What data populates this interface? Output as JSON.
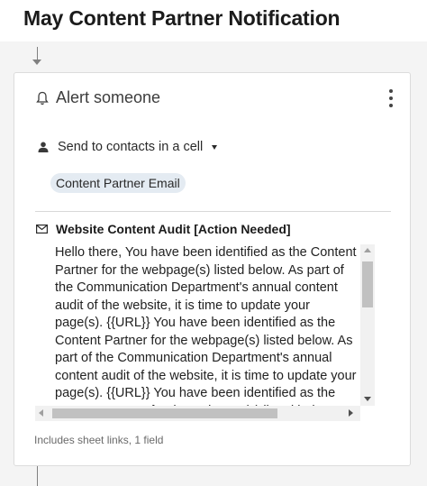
{
  "page": {
    "title": "May Content Partner Notification"
  },
  "card": {
    "action_label": "Alert someone",
    "more_icon": "vertical-ellipsis-icon",
    "recipient": {
      "label": "Send to contacts in a cell",
      "chip": "Content Partner Email"
    },
    "email": {
      "subject": "Website Content Audit [Action Needed]",
      "body": "Hello there, You have been identified as the Content Partner for the webpage(s) listed below. As part of the Communication Department's annual content audit of the website, it is time to update your page(s). {{URL}} You have been identified as the Content Partner for the webpage(s) listed below. As part of the Communication Department's annual content audit of the website, it is time to update your page(s). {{URL}} You have been identified as the Content Partner for the webpage(s) listed below."
    },
    "footer": "Includes sheet links, 1 field"
  },
  "colors": {
    "chip_bg": "#e4ebf2",
    "card_bg": "#ffffff",
    "page_bg": "#f4f4f4",
    "connector": "#808080"
  }
}
